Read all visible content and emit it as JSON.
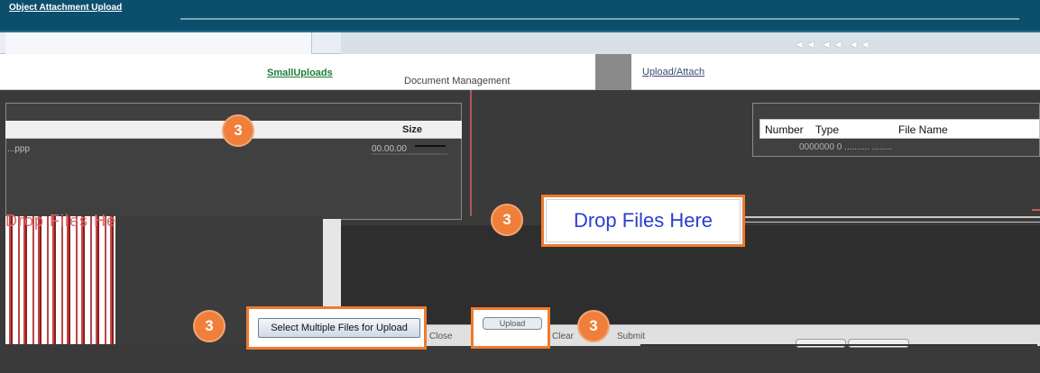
{
  "window": {
    "title": "Object Attachment Upload"
  },
  "nav": {
    "arrows": "◄◄ ◄◄ ◄◄"
  },
  "tabs": {
    "green": "SmallUploads",
    "document": "Document Management",
    "link": "Upload/Attach"
  },
  "left_grid": {
    "size_header": "Size",
    "row_text": "...ppp",
    "row_value": "00.00.00"
  },
  "right_grid": {
    "headers": {
      "number": "Number",
      "type": "Type",
      "file_name": "File Name"
    },
    "row_text": "0000000  0  ..........  ........"
  },
  "drop_zone": {
    "left_label": "Drop Files Here",
    "callout_label": "Drop Files Here"
  },
  "buttons": {
    "select_multiple": "Select Multiple Files for Upload",
    "upload": "Upload",
    "close": "Close",
    "clear": "Clear",
    "submit": "Submit"
  },
  "badges": [
    "3",
    "3",
    "3",
    "3"
  ],
  "colors": {
    "accent": "#ef7f3b",
    "title_bar": "#0c4f6d",
    "drop_text": "#2a3fd0"
  }
}
